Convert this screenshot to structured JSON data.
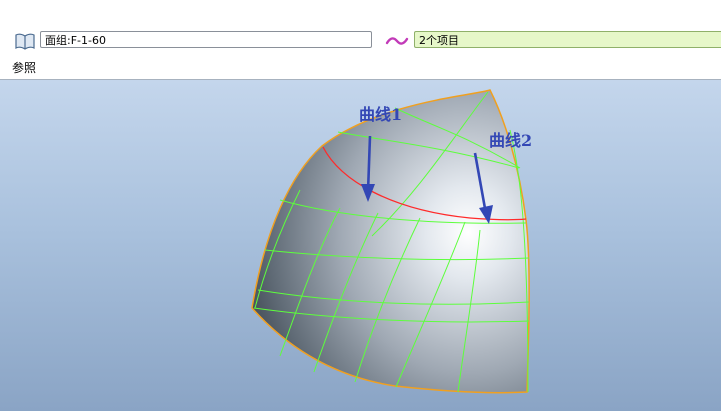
{
  "toolbar": {
    "reference_icon": "book-icon",
    "surface_field_value": "面组:F-1-60",
    "curve_icon": "tilde-curve-icon",
    "items_field_value": "2个项目",
    "references_tab": "参照"
  },
  "viewport": {
    "labels": {
      "curve1": "曲线1",
      "curve2": "曲线2"
    },
    "colors": {
      "background_top": "#c4d6ec",
      "background_bottom": "#8aa4c5",
      "selected_curve": "#ff2a2a",
      "isolines": "#5dff3c",
      "surface_edge": "#f0a020",
      "annotation_arrows": "#3347b5"
    }
  }
}
